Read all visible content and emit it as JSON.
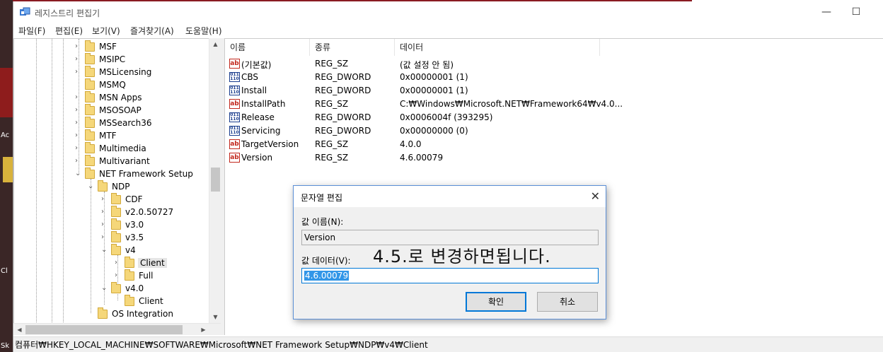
{
  "window": {
    "title": "레지스트리 편집기",
    "minimize": "—",
    "maximize": "☐"
  },
  "menu": [
    "파일(F)",
    "편집(E)",
    "보기(V)",
    "즐겨찾기(A)",
    "도움말(H)"
  ],
  "tree": [
    "MSF",
    "MSIPC",
    "MSLicensing",
    "MSMQ",
    "MSN Apps",
    "MSOSOAP",
    "MSSearch36",
    "MTF",
    "Multimedia",
    "Multivariant",
    "NET Framework Setup",
    "NDP",
    "CDF",
    "v2.0.50727",
    "v3.0",
    "v3.5",
    "v4",
    "Client",
    "Full",
    "v4.0",
    "Client",
    "OS Integration"
  ],
  "list": {
    "headers": [
      "이름",
      "종류",
      "데이터"
    ],
    "rows": [
      {
        "icon": "ab",
        "name": "(기본값)",
        "type": "REG_SZ",
        "data": "(값 설정 안 됨)"
      },
      {
        "icon": "bin",
        "name": "CBS",
        "type": "REG_DWORD",
        "data": "0x00000001 (1)"
      },
      {
        "icon": "bin",
        "name": "Install",
        "type": "REG_DWORD",
        "data": "0x00000001 (1)"
      },
      {
        "icon": "ab",
        "name": "InstallPath",
        "type": "REG_SZ",
        "data": "C:₩Windows₩Microsoft.NET₩Framework64₩v4.0..."
      },
      {
        "icon": "bin",
        "name": "Release",
        "type": "REG_DWORD",
        "data": "0x0006004f (393295)"
      },
      {
        "icon": "bin",
        "name": "Servicing",
        "type": "REG_DWORD",
        "data": "0x00000000 (0)"
      },
      {
        "icon": "ab",
        "name": "TargetVersion",
        "type": "REG_SZ",
        "data": "4.0.0"
      },
      {
        "icon": "ab",
        "name": "Version",
        "type": "REG_SZ",
        "data": "4.6.00079"
      }
    ]
  },
  "status": "컴퓨터₩HKEY_LOCAL_MACHINE₩SOFTWARE₩Microsoft₩NET Framework Setup₩NDP₩v4₩Client",
  "dialog": {
    "title": "문자열 편집",
    "close": "✕",
    "name_label": "값 이름(N):",
    "name_value": "Version",
    "data_label": "값 데이터(V):",
    "data_value": "4.6.00079",
    "overlay_text": "4.5.로  변경하면됩니다.",
    "ok": "확인",
    "cancel": "취소"
  },
  "icons": {
    "string": "ab",
    "dword_top": "011",
    "dword_bottom": "110"
  },
  "desktop": {
    "label1": "Ac",
    "label2": "Cl",
    "label3": "Sk"
  }
}
